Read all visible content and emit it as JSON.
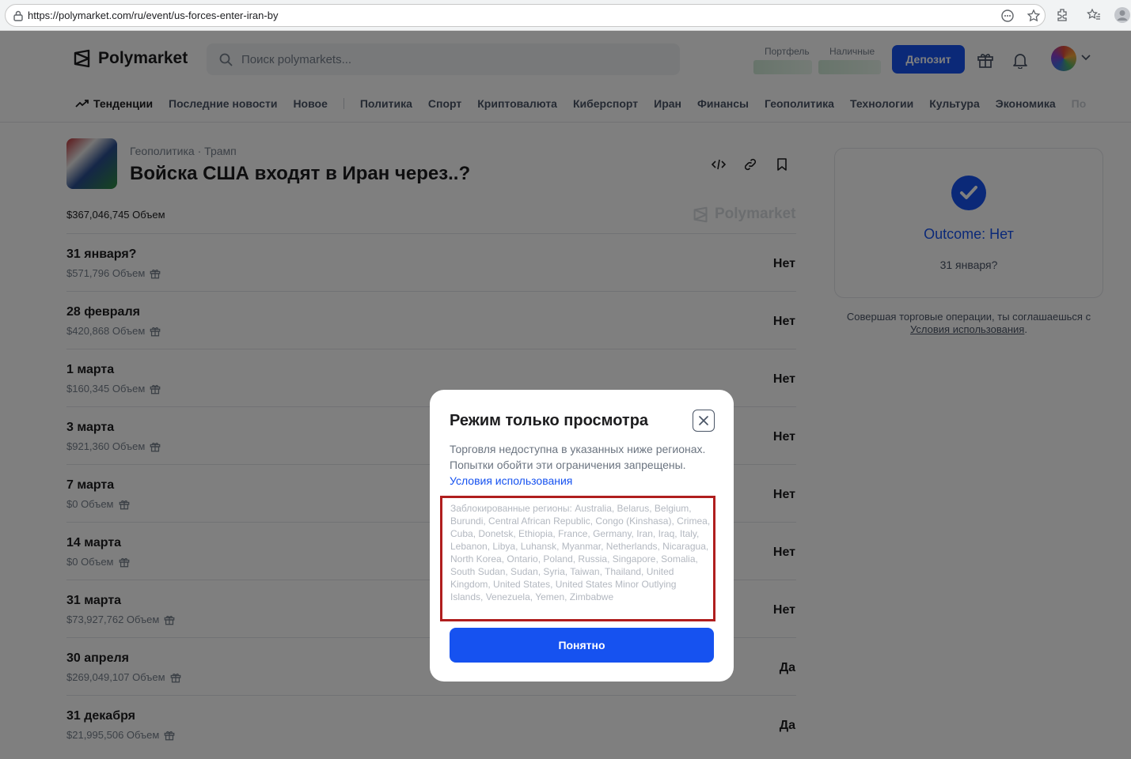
{
  "browser": {
    "url": "https://polymarket.com/ru/event/us-forces-enter-iran-by"
  },
  "header": {
    "logo_text": "Polymarket",
    "search_placeholder": "Поиск polymarkets...",
    "portfolio_label": "Портфель",
    "cash_label": "Наличные",
    "deposit_label": "Депозит"
  },
  "nav": {
    "trending": "Тенденции",
    "items": [
      "Последние новости",
      "Новое"
    ],
    "categories": [
      "Политика",
      "Спорт",
      "Криптовалюта",
      "Киберспорт",
      "Иран",
      "Финансы",
      "Геополитика",
      "Технологии",
      "Культура",
      "Экономика"
    ],
    "overflow": "По"
  },
  "event": {
    "breadcrumb_1": "Геополитика",
    "breadcrumb_sep": "·",
    "breadcrumb_2": "Трамп",
    "title": "Войска США входят в Иран через..?",
    "volume": "$367,046,745 Объем",
    "watermark": "Polymarket"
  },
  "markets": [
    {
      "date": "31 января?",
      "volume": "$571,796 Объем",
      "outcome": "Нет"
    },
    {
      "date": "28 февраля",
      "volume": "$420,868 Объем",
      "outcome": "Нет"
    },
    {
      "date": "1 марта",
      "volume": "$160,345 Объем",
      "outcome": "Нет"
    },
    {
      "date": "3 марта",
      "volume": "$921,360 Объем",
      "outcome": "Нет"
    },
    {
      "date": "7 марта",
      "volume": "$0 Объем",
      "outcome": "Нет"
    },
    {
      "date": "14 марта",
      "volume": "$0 Объем",
      "outcome": "Нет"
    },
    {
      "date": "31 марта",
      "volume": "$73,927,762 Объем",
      "outcome": "Нет"
    },
    {
      "date": "30 апреля",
      "volume": "$269,049,107 Объем",
      "outcome": "Да"
    },
    {
      "date": "31 декабря",
      "volume": "$21,995,506 Объем",
      "outcome": "Да"
    }
  ],
  "sidebar": {
    "outcome": "Outcome: Нет",
    "question": "31 января?",
    "terms_prefix": "Совершая торговые операции, ты соглашаешься с",
    "terms_link": "Условия использования",
    "terms_suffix": "."
  },
  "modal": {
    "title": "Режим только просмотра",
    "description": "Торговля недоступна в указанных ниже регионах. Попытки обойти эти ограничения запрещены.",
    "terms_link": "Условия использования",
    "regions": "Заблокированные регионы: Australia, Belarus, Belgium, Burundi, Central African Republic, Congo (Kinshasa), Crimea, Cuba, Donetsk, Ethiopia, France, Germany, Iran, Iraq, Italy, Lebanon, Libya, Luhansk, Myanmar, Netherlands, Nicaragua, North Korea, Ontario, Poland, Russia, Singapore, Somalia, South Sudan, Sudan, Syria, Taiwan, Thailand, United Kingdom, United States, United States Minor Outlying Islands, Venezuela, Yemen, Zimbabwe",
    "ok_label": "Понятно"
  },
  "colors": {
    "accent": "#1652f0",
    "highlight_border": "#b01e1e"
  }
}
